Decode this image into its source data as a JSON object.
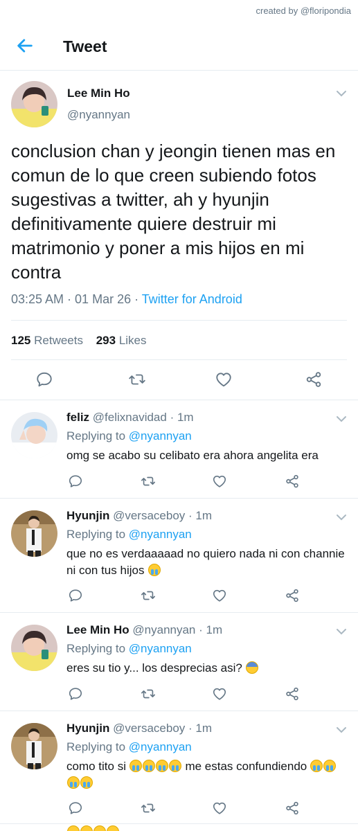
{
  "credit": "created by @floripondia",
  "header": {
    "title": "Tweet"
  },
  "main_tweet": {
    "name": "Lee Min Ho",
    "handle": "@nyannyan",
    "text": "conclusion chan y jeongin tienen mas en comun de lo que creen subiendo fotos sugestivas a twitter, ah y hyunjin definitivamente quiere destruir mi matrimonio y poner a mis hijos en mi contra",
    "time": "03:25 AM · 01 Mar 26 · ",
    "source": "Twitter for Android",
    "retweets_count": "125",
    "retweets_label": "Retweets",
    "likes_count": "293",
    "likes_label": "Likes"
  },
  "replies": [
    {
      "name": "feliz",
      "handle": "@felixnavidad",
      "time": "· 1m",
      "replying_prefix": "Replying to ",
      "replying_to": "@nyannyan",
      "text": "omg se acabo su celibato era ahora angelita era",
      "emojis": []
    },
    {
      "name": "Hyunjin",
      "handle": "@versaceboy",
      "time": "· 1m",
      "replying_prefix": "Replying to ",
      "replying_to": "@nyannyan",
      "text": "que no es verdaaaaad no quiero nada ni con channie ni con tus hijos",
      "emojis": [
        "loudly-crying-face"
      ]
    },
    {
      "name": "Lee Min Ho",
      "handle": "@nyannyan",
      "time": "· 1m",
      "replying_prefix": "Replying to ",
      "replying_to": "@nyannyan",
      "text": "eres su tio y... los desprecias asi?",
      "emojis": [
        "fearful-face"
      ]
    },
    {
      "name": "Hyunjin",
      "handle": "@versaceboy",
      "time": "· 1m",
      "replying_prefix": "Replying to ",
      "replying_to": "@nyannyan",
      "text_before": "como tito si",
      "text_after": "me estas confundiendo",
      "emojis": [
        "loudly-crying-face x4",
        "loudly-crying-face x4"
      ]
    }
  ],
  "icons": {
    "back": "arrow-left-icon",
    "caret": "chevron-down-icon",
    "reply": "comment-icon",
    "retweet": "retweet-icon",
    "like": "heart-icon",
    "share": "share-icon"
  },
  "colors": {
    "accent": "#1da1f2",
    "secondary_text": "#657786",
    "divider": "#e6ecf0",
    "icon": "#657786"
  }
}
